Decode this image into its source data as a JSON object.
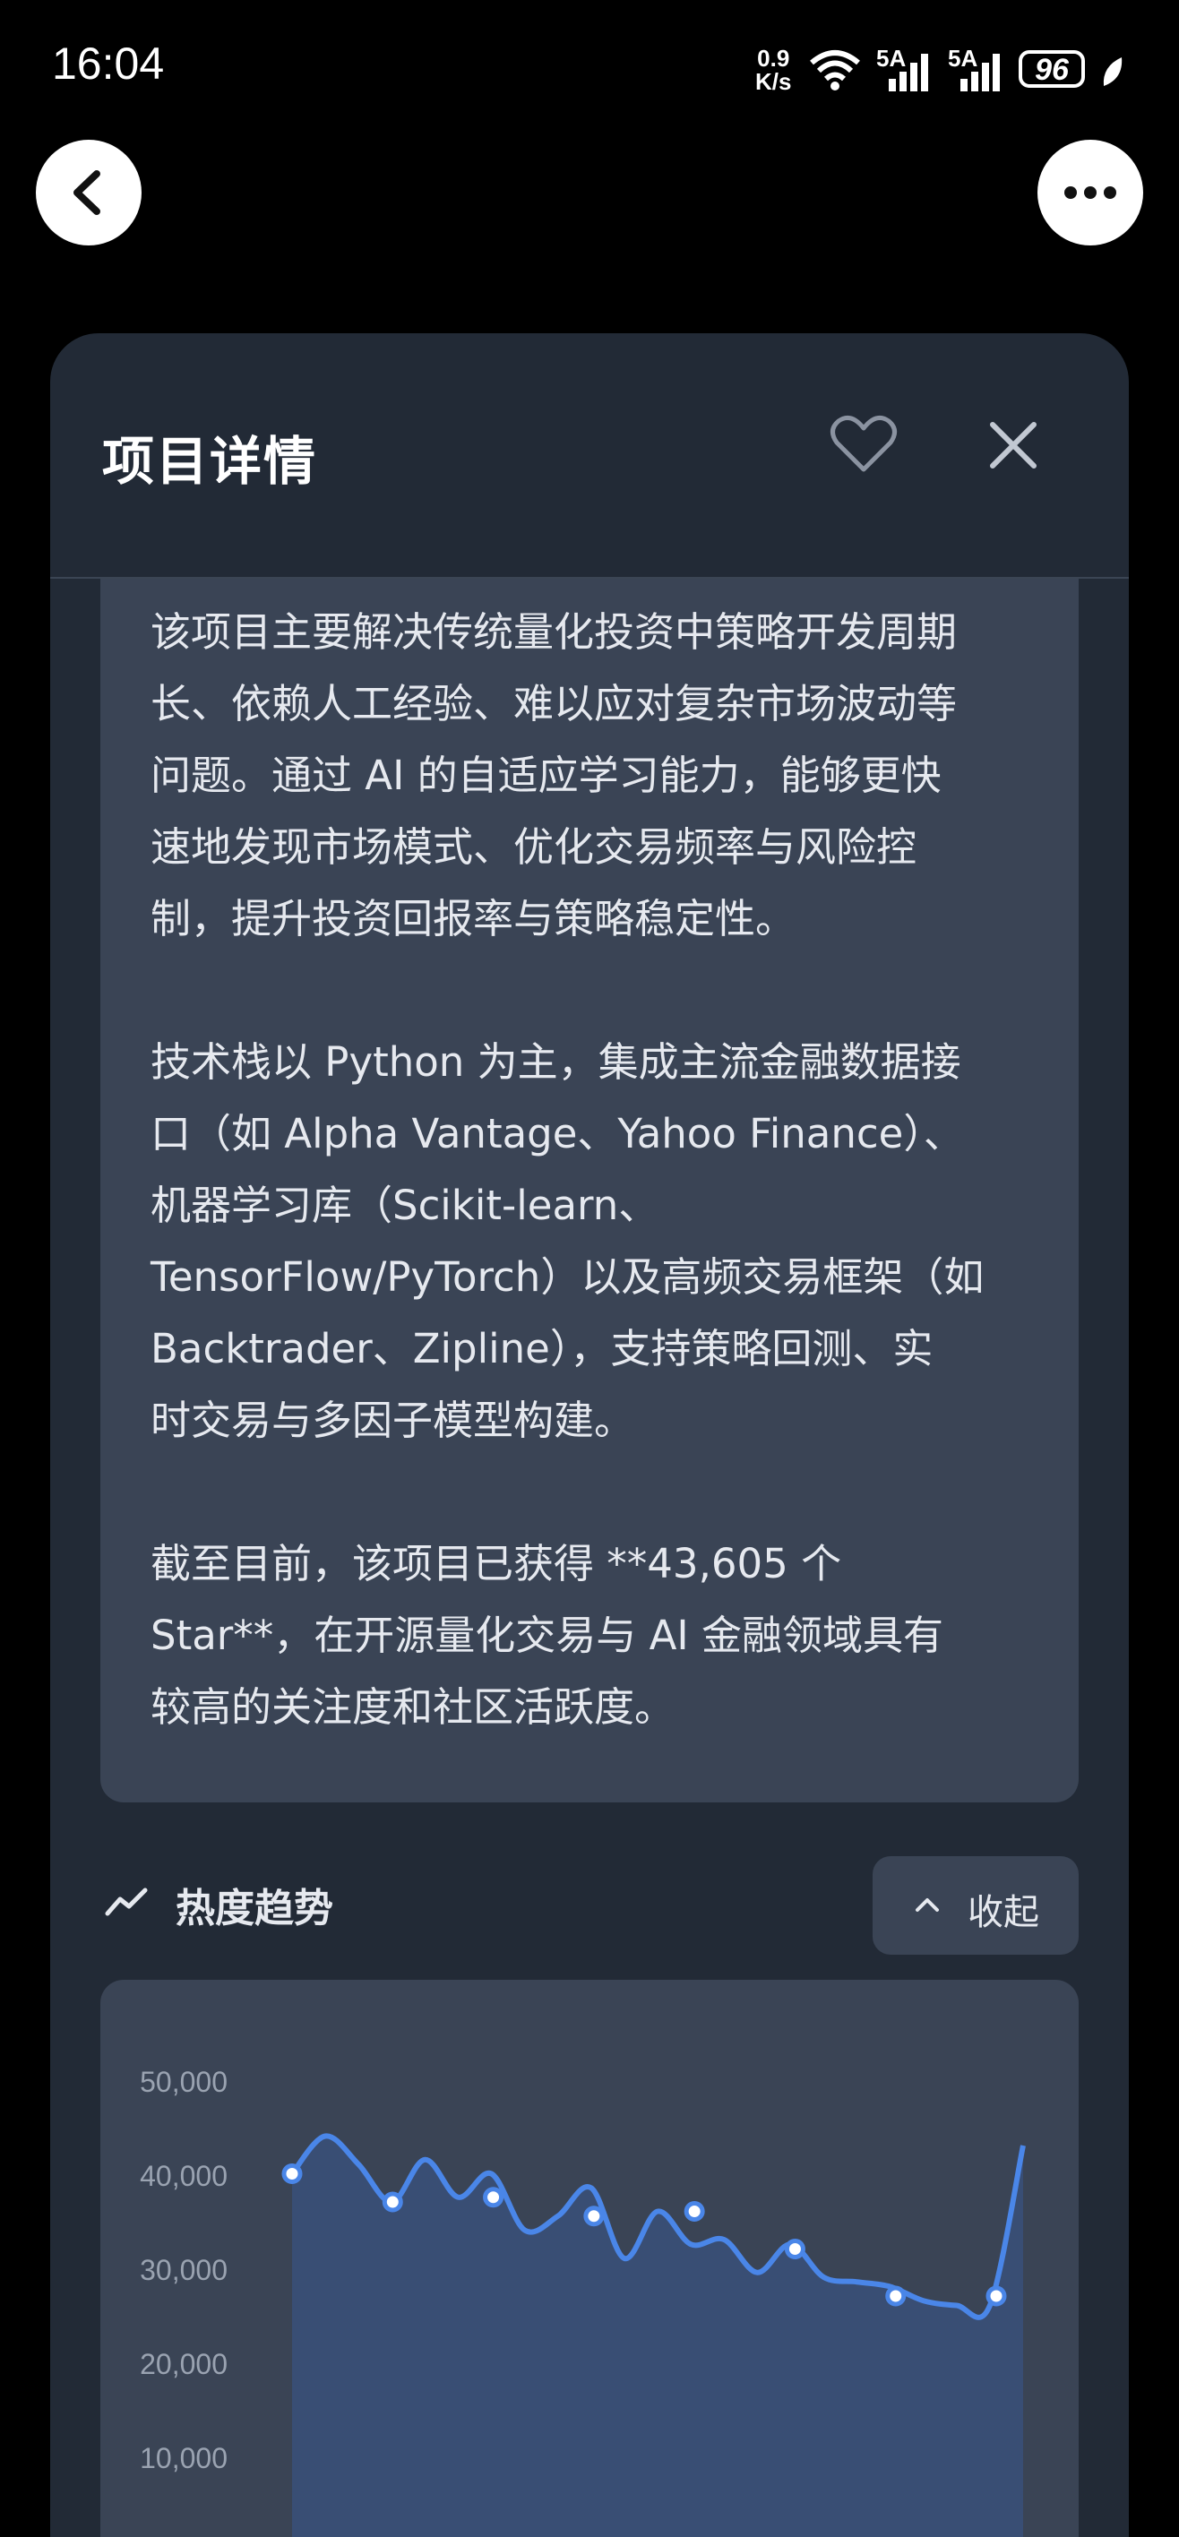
{
  "status_bar": {
    "time": "16:04",
    "net_speed_value": "0.9",
    "net_speed_unit": "K/s",
    "signal1": "5A",
    "signal2": "5A",
    "battery": "96"
  },
  "panel": {
    "title": "项目详情",
    "description": [
      "该项目主要解决传统量化投资中策略开发周期",
      "长、依赖人工经验、难以应对复杂市场波动等",
      "问题。通过 AI 的自适应学习能力，能够更快",
      "速地发现市场模式、优化交易频率与风险控",
      "制，提升投资回报率与策略稳定性。"
    ],
    "tech_stack": [
      "技术栈以 Python 为主，集成主流金融数据接",
      "口（如 Alpha Vantage、Yahoo Finance）、",
      "机器学习库（Scikit-learn、",
      "TensorFlow/PyTorch）以及高频交易框架（如",
      "Backtrader、Zipline），支持策略回测、实",
      "时交易与多因子模型构建。"
    ],
    "stars": [
      "截至目前，该项目已获得 **43,605 个",
      "Star**，在开源量化交易与 AI 金融领域具有",
      "较高的关注度和社区活跃度。"
    ],
    "trend_title": "热度趋势",
    "collapse_label": "收起"
  },
  "icons": {
    "back": "chevron-left-icon",
    "more": "more-dots-icon",
    "favorite": "heart-outline-icon",
    "close": "close-icon",
    "trend": "trend-line-icon",
    "collapse": "chevron-up-icon"
  },
  "colors": {
    "panel_bg": "#222a36",
    "card_bg": "#3a4455",
    "line": "#4a86e8",
    "area": "#3a5078"
  },
  "chart_data": {
    "type": "area",
    "title": "",
    "xlabel": "",
    "ylabel": "",
    "y_ticks": [
      "50,000",
      "40,000",
      "30,000",
      "20,000",
      "10,000"
    ],
    "ylim": [
      10000,
      50000
    ],
    "series": [
      {
        "points": [
          41000,
          45000,
          42000,
          38000,
          42500,
          38500,
          41000,
          35000,
          36500,
          39500,
          32000,
          37000,
          33500,
          34000,
          30500,
          33500,
          30000,
          29500,
          29000,
          27500,
          27000,
          27000,
          44000
        ],
        "markers": [
          41000,
          38000,
          38500,
          36500,
          37000,
          33000,
          28000,
          28000
        ]
      }
    ]
  }
}
